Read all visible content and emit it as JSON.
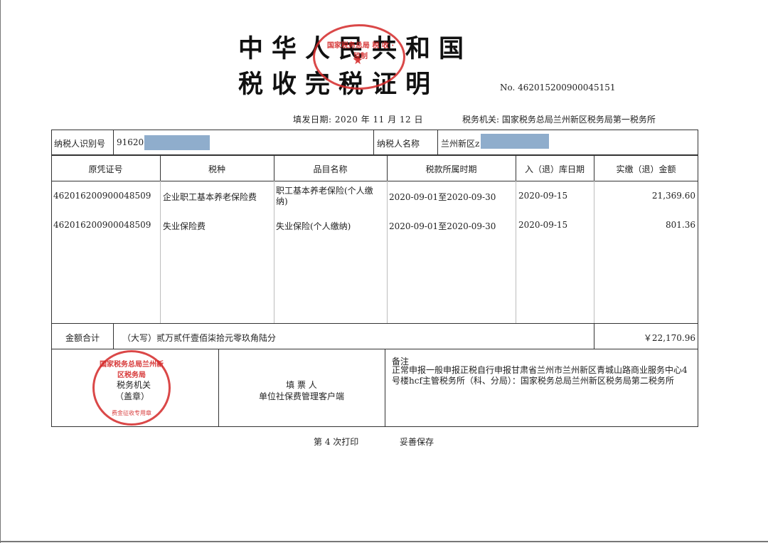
{
  "document": {
    "title_line1": "中华人民共和国",
    "title_line2": "税收完税证明",
    "number": "No.  462015200900045151",
    "fill_date": "填发日期:  2020  年 11  月 12  日",
    "tax_office": "税务机关:  国家税务总局兰州新区税务局第一税务所"
  },
  "taxpayer": {
    "id_label": "纳税人识别号",
    "id_value": "91620",
    "name_label": "纳税人名称",
    "name_value": "兰州新区z"
  },
  "table": {
    "headers": [
      "原凭证号",
      "税种",
      "品目名称",
      "税款所属时期",
      "入（退）库日期",
      "实缴（退）金额"
    ],
    "rows": [
      {
        "voucher": "462016200900048509",
        "tax_type": "企业职工基本养老保险费",
        "item": "职工基本养老保险(个人缴纳)",
        "period": "2020-09-01至2020-09-30",
        "date": "2020-09-15",
        "amount": "21,369.60"
      },
      {
        "voucher": "462016200900048509",
        "tax_type": "失业保险费",
        "item": "失业保险(个人缴纳)",
        "period": "2020-09-01至2020-09-30",
        "date": "2020-09-15",
        "amount": "801.36"
      }
    ]
  },
  "total": {
    "label": "金额合计",
    "words": "（大写）贰万贰仟壹佰柒拾元零玖角陆分",
    "amount": "￥22,170.96"
  },
  "footer": {
    "seal_label_line1": "税务机关",
    "seal_label_line2": "（盖章）",
    "filler_line1": "填 票 人",
    "filler_line2": "单位社保费管理客户端",
    "remark_label": "备注",
    "remark_text": "正常申报一般申报正税自行申报甘肃省兰州市兰州新区青城山路商业服务中心4号楼hcf主管税务所（科、分局）：国家税务总局兰州新区税务局第二税务所"
  },
  "print": {
    "count": "第 4 次打印",
    "keep": "妥善保存"
  },
  "seals": {
    "top_seal_text": "国家税务总局 税 收 ·监制",
    "bottom_seal_text": "国家税务总局兰州新区税务局",
    "bottom_seal_small": "费金征收专用章",
    "color": "#d42828"
  }
}
